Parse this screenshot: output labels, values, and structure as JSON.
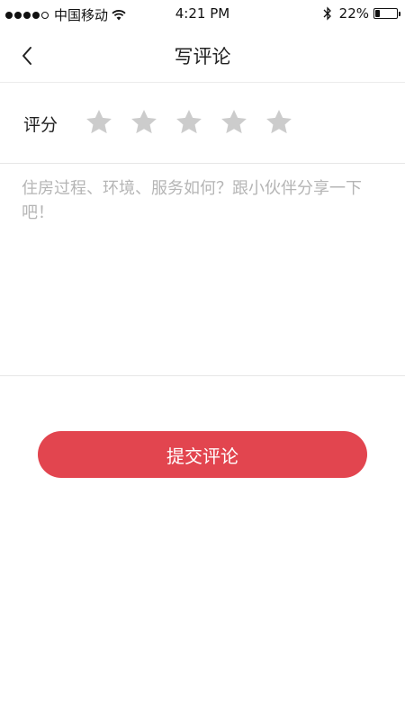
{
  "status_bar": {
    "carrier": "中国移动",
    "time": "4:21 PM",
    "battery": "22%",
    "battery_level": 0.22,
    "signal_bars": 4,
    "signal_max": 5
  },
  "nav": {
    "title": "写评论",
    "back_icon": "chevron-left-icon"
  },
  "rating": {
    "label": "评分",
    "max": 5,
    "value": 0,
    "star_color_empty": "#cccccc"
  },
  "review": {
    "value": "",
    "placeholder": "住房过程、环境、服务如何？跟小伙伴分享一下吧！"
  },
  "submit": {
    "label": "提交评论",
    "color": "#e2454f"
  }
}
